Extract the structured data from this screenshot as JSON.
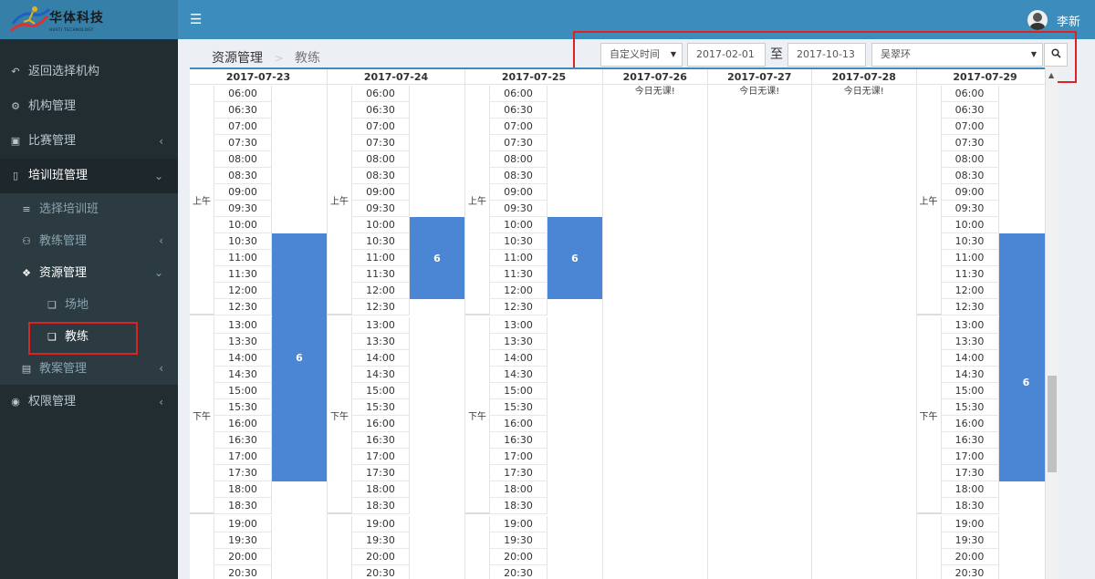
{
  "app": {
    "brand": "华体科技",
    "brand_sub": "HUATI TECHNOLOGY"
  },
  "header": {
    "user_name": "李新"
  },
  "sidebar": {
    "items": [
      {
        "label": "返回选择机构",
        "icon": "back-arrow-icon"
      },
      {
        "label": "机构管理",
        "icon": "gear-icon"
      },
      {
        "label": "比赛管理",
        "icon": "trophy-icon"
      },
      {
        "label": "培训班管理",
        "icon": "book-icon"
      },
      {
        "label": "选择培训班",
        "icon": "list-icon"
      },
      {
        "label": "教练管理",
        "icon": "users-icon"
      },
      {
        "label": "资源管理",
        "icon": "cubes-icon"
      },
      {
        "label": "场地",
        "icon": "cube-icon"
      },
      {
        "label": "教练",
        "icon": "cube-icon"
      },
      {
        "label": "教案管理",
        "icon": "archive-icon"
      },
      {
        "label": "权限管理",
        "icon": "lock-icon"
      }
    ]
  },
  "breadcrumb": {
    "root": "资源管理",
    "sep": ">",
    "current": "教练"
  },
  "toolbar": {
    "time_mode": "自定义时间",
    "start_date": "2017-02-01",
    "to_text": "至",
    "end_date": "2017-10-13",
    "coach": "吴翠环"
  },
  "schedule": {
    "am_label": "上午",
    "pm_label": "下午",
    "no_class_text": "今日无课!",
    "days": [
      {
        "date": "2017-07-23",
        "has_class": true
      },
      {
        "date": "2017-07-24",
        "has_class": true
      },
      {
        "date": "2017-07-25",
        "has_class": true
      },
      {
        "date": "2017-07-26",
        "has_class": false
      },
      {
        "date": "2017-07-27",
        "has_class": false
      },
      {
        "date": "2017-07-28",
        "has_class": false
      },
      {
        "date": "2017-07-29",
        "has_class": true
      }
    ],
    "times": [
      "06:00",
      "06:30",
      "07:00",
      "07:30",
      "08:00",
      "08:30",
      "09:00",
      "09:30",
      "10:00",
      "10:30",
      "11:00",
      "11:30",
      "12:00",
      "12:30",
      "13:00",
      "13:30",
      "14:00",
      "14:30",
      "15:00",
      "15:30",
      "16:00",
      "16:30",
      "17:00",
      "17:30",
      "18:00",
      "18:30",
      "19:00",
      "19:30",
      "20:00",
      "20:30"
    ],
    "bookings": [
      {
        "day": "2017-07-23",
        "start": "10:30",
        "end": "18:00",
        "count": "6"
      },
      {
        "day": "2017-07-24",
        "start": "10:00",
        "end": "12:30",
        "count": "6"
      },
      {
        "day": "2017-07-25",
        "start": "10:00",
        "end": "12:30",
        "count": "6"
      },
      {
        "day": "2017-07-29",
        "start": "10:30",
        "end": "12:00",
        "count": ""
      },
      {
        "day": "2017-07-29",
        "start": "12:00",
        "end": "18:00",
        "count": "6"
      }
    ]
  },
  "colors": {
    "header": "#3c8dbc",
    "sidebar": "#222d32",
    "booking": "#4a86d4",
    "highlight": "#dd2222"
  }
}
